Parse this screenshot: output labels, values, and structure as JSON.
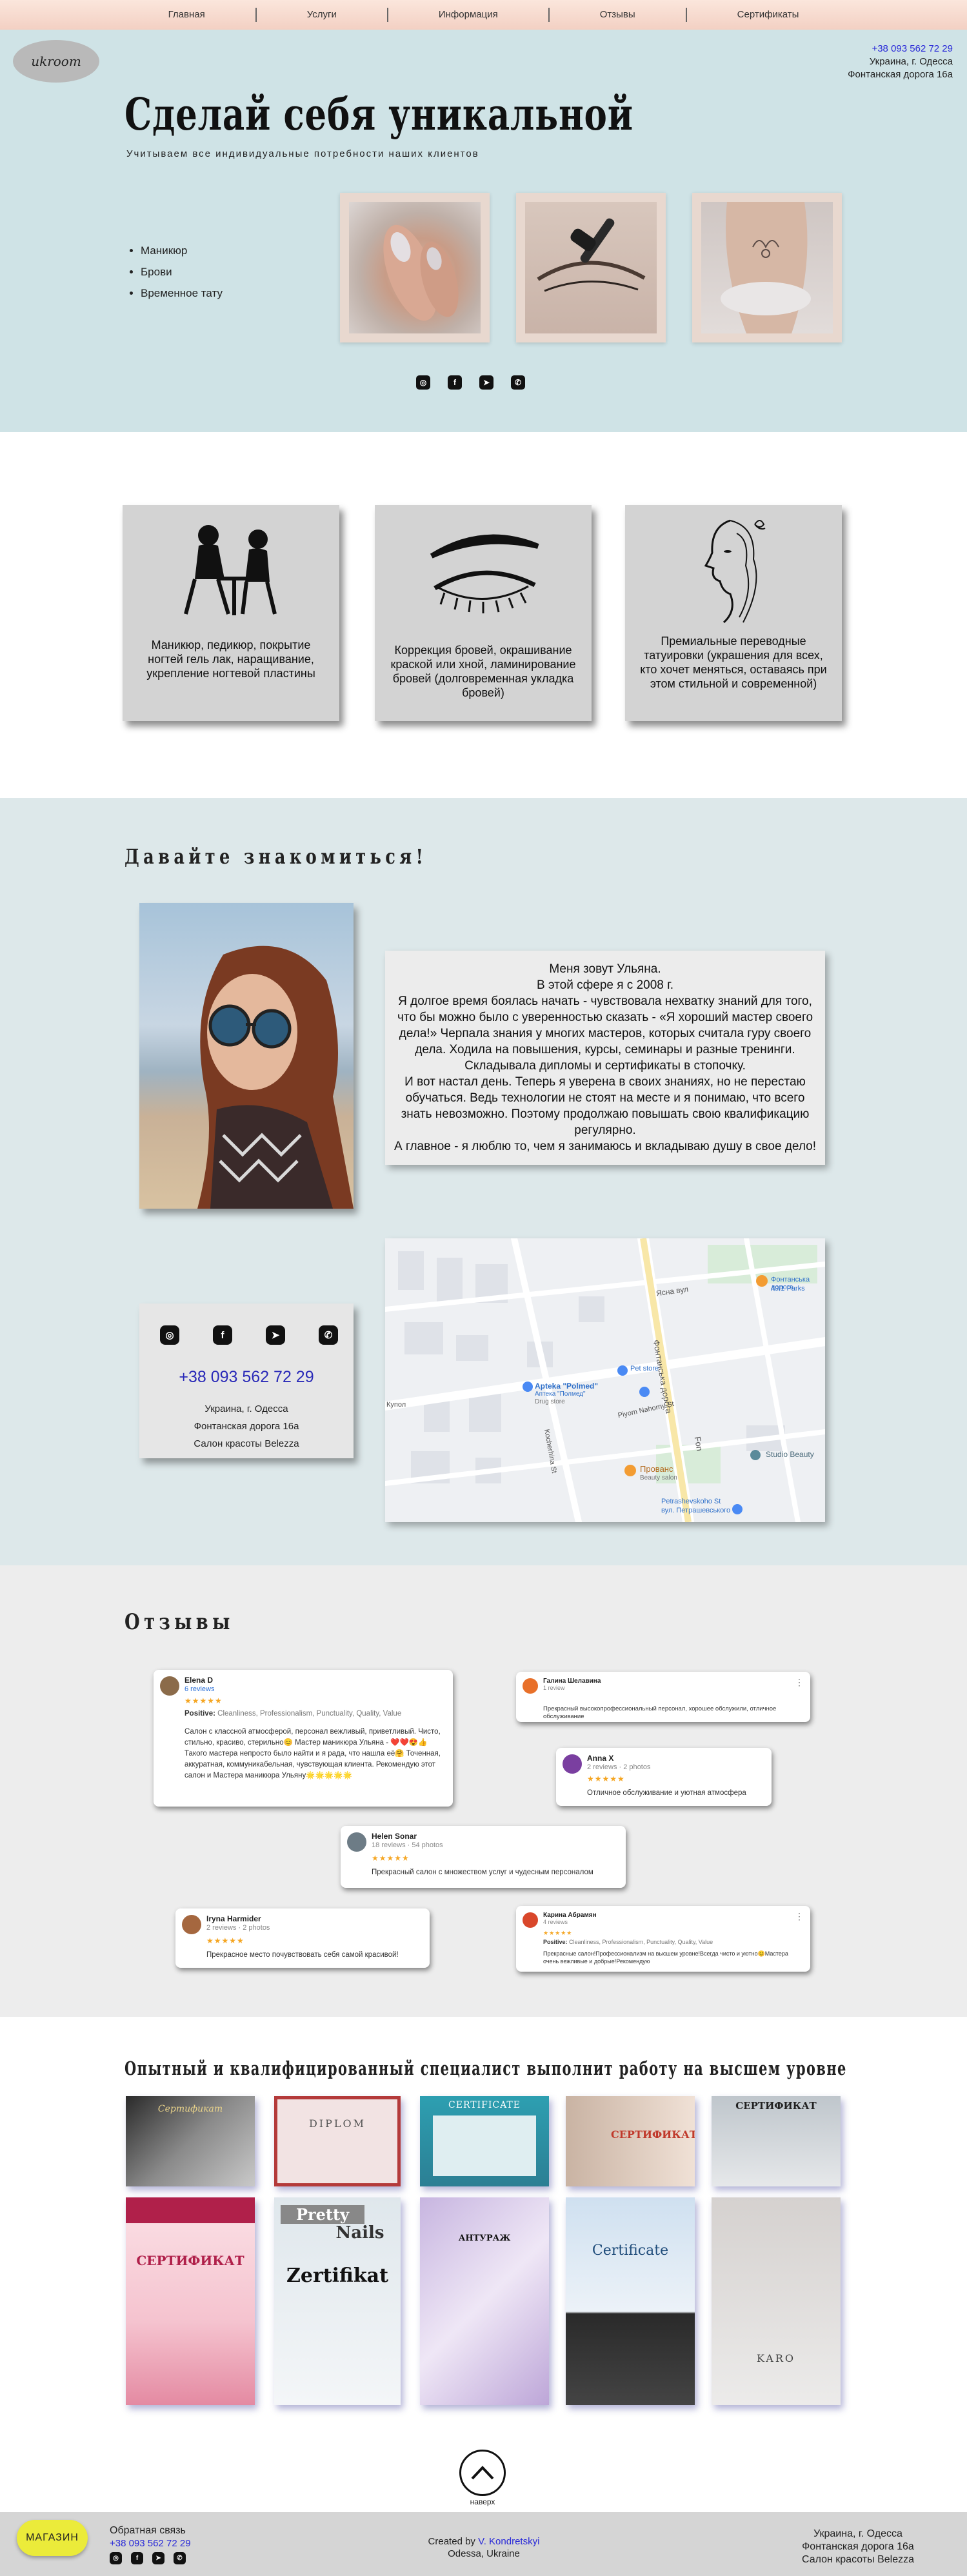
{
  "nav": {
    "items": [
      {
        "label": "Главная"
      },
      {
        "label": "Услуги"
      },
      {
        "label": "Информация"
      },
      {
        "label": "Отзывы"
      },
      {
        "label": "Сертификаты"
      }
    ]
  },
  "logo": {
    "text": "ukroom"
  },
  "contact": {
    "phone": "+38 093 562 72 29",
    "city": "Украина, г. Одесса",
    "street": "Фонтанская дорога 16а",
    "salon": "Салон красоты Belezza"
  },
  "hero": {
    "title": "Сделай себя уникальной",
    "subtitle": "Учитываем все индивидуальные потребности наших клиентов",
    "list": [
      "Маникюр",
      "Брови",
      "Временное тату"
    ]
  },
  "services": [
    {
      "text": "Маникюр, педикюр, покрытие ногтей гель лак, наращивание, укрепление ногтевой пластины"
    },
    {
      "text": "Коррекция бровей, окрашивание краской или хной, ламинирование бровей (долговременная укладка бровей)"
    },
    {
      "text": "Премиальные переводные татуировки (украшения для всех, кто хочет меняться, оставаясь при этом стильной и современной)"
    }
  ],
  "about": {
    "title": "Давайте знакомиться!",
    "lines": [
      "Меня зовут Ульяна.",
      "В этой сфере я с 2008 г.",
      "Я долгое время боялась начать - чувствовала нехватку знаний для того, что бы можно было с уверенностью сказать - «Я хороший мастер своего дела!» Черпала знания у многих мастеров, которых считала гуру своего дела. Ходила на повышения, курсы, семинары и разные тренинги. Складывала дипломы и сертификаты в стопочку.",
      "И вот настал день. Теперь я уверена в своих знаниях, но не перестаю обучаться. Ведь технологии не стоят на месте и я понимаю, что всего знать невозможно. Поэтому продолжаю повышать свою квалификацию регулярно.",
      "А главное - я люблю то, чем я занимаюсь и вкладываю душу в свое дело!"
    ]
  },
  "map": {
    "labels": {
      "street1": "Фонтанська дорога",
      "street2": "Ясна вул",
      "street3": "Kocherhina St",
      "street4": "Piyom Nahorny St",
      "street5": "Skvortsov St",
      "pet": "Pet store",
      "apteka": "Apteka \"Polmed\"",
      "apteka_sub": "Аптека \"Полмед\"",
      "apteka_sub2": "Drug store",
      "provans": "Прованс",
      "provans_sub": "Beauty salon",
      "studio": "Studio Beauty",
      "fontanska": "Фонтанська дорога",
      "fontanska_sub": "49/1 Parks",
      "petr": "Petrashevskoho St",
      "petr_sub": "вул. Петрашевського",
      "kupol": "Купол",
      "fon": "Fon"
    }
  },
  "reviews": {
    "title": "Отзывы",
    "items": [
      {
        "name": "Elena D",
        "meta": "6 reviews",
        "stars": "★★★★★",
        "positive_label": "Positive:",
        "positive": "Cleanliness, Professionalism, Punctuality, Quality, Value",
        "body": "Салон с классной атмосферой, персонал вежливый, приветливый. Чисто, стильно, красиво, стерильно😊 Мастер маникюра Ульяна - ❤️❤️😍👍 Такого мастера непросто было найти и я рада, что нашла её🤗 Точенная, аккуратная, коммуникабельная, чувствующая клиента. Рекомендую этот салон и Мастера маникюра Ульяну🌟🌟🌟🌟🌟",
        "avatar_color": "#8b6b4a"
      },
      {
        "name": "Галина Шелавина",
        "meta": "1 review",
        "stars": "",
        "positive_label": "",
        "positive": "",
        "body": "Прекрасный высокопрофессиональный персонал, хорошее обслужили, отличное обслуживание",
        "avatar_color": "#e8702a"
      },
      {
        "name": "Anna X",
        "meta": "2 reviews · 2 photos",
        "stars": "★★★★★",
        "positive_label": "",
        "positive": "",
        "body": "Отличное обслуживание и уютная атмосфера",
        "avatar_color": "#7a3fa0"
      },
      {
        "name": "Helen Sonar",
        "meta": "18 reviews · 54 photos",
        "stars": "★★★★★",
        "positive_label": "",
        "positive": "",
        "body": "Прекрасный салон с множеством услуг и чудесным персоналом",
        "avatar_color": "#6d7c86"
      },
      {
        "name": "Iryna Harmider",
        "meta": "2 reviews · 2 photos",
        "stars": "★★★★★",
        "positive_label": "",
        "positive": "",
        "body": "Прекрасное место почувствовать себя самой красивой!",
        "avatar_color": "#a5673f"
      },
      {
        "name": "Карина Абрамян",
        "meta": "4 reviews",
        "stars": "★★★★★",
        "positive_label": "Positive:",
        "positive": "Cleanliness, Professionalism, Punctuality, Quality, Value",
        "body": "Прекрасные салон!Профессионализм на высшем уровне!Всегда чисто и уютно😊Мастера очень вежливые и добрые!Рекомендую",
        "avatar_color": "#d9472b"
      }
    ]
  },
  "certificates": {
    "title": "Опытный и квалифицированный специалист выполнит работу на высшем уровне",
    "labels": {
      "c1": "Сертификат",
      "c2": "DIPLOM",
      "c3": "CERTIFICATE",
      "c4": "СЕРТИФИКАТ",
      "c5": "СЕРТИФИКАТ",
      "c6": "СЕРТИФИКАТ",
      "c7a": "Pretty",
      "c7b": "Nails",
      "c7c": "Zertifikat",
      "c8": "АНТУРАЖ",
      "c9": "Certificate",
      "c10": "KARO"
    }
  },
  "to_top": {
    "label": "наверх"
  },
  "footer": {
    "shop": "МАГАЗИН",
    "feedback": "Обратная связь",
    "phone": "+38 093 562 72 29",
    "created_by": "Created by",
    "author": "V. Kondretskyi",
    "location": "Odessa, Ukraine",
    "city": "Украина, г. Одесса",
    "street": "Фонтанская дорога 16а",
    "salon": "Салон красоты Belezza"
  },
  "icons": [
    "instagram-icon",
    "facebook-icon",
    "telegram-icon",
    "viber-icon"
  ],
  "colors": {
    "nav_bg": "#f3d0c3",
    "hero_bg": "#cfe3e6",
    "about_bg": "#dde8ea",
    "reviews_bg": "#ededed",
    "card_bg": "#d3d3d3",
    "shop_btn": "#ebeb3a",
    "link": "#2a2ad8"
  }
}
